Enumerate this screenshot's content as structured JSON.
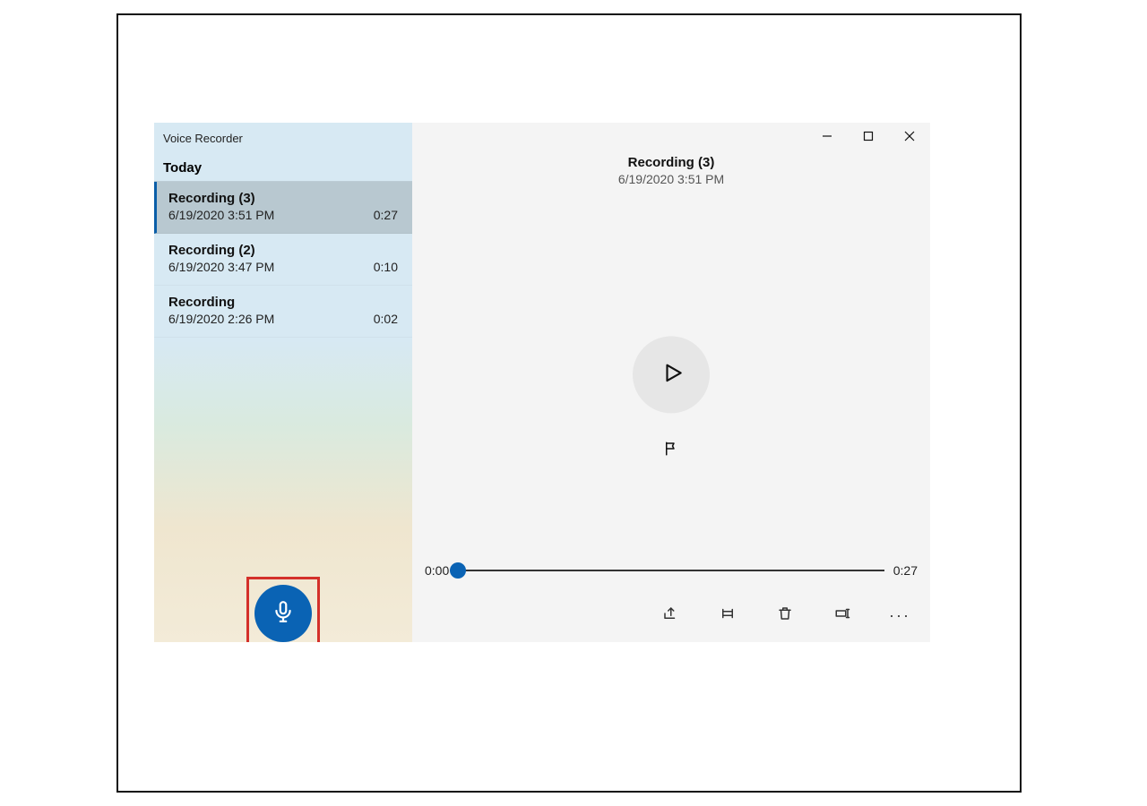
{
  "app": {
    "title": "Voice Recorder"
  },
  "sidebar": {
    "group": "Today",
    "items": [
      {
        "title": "Recording (3)",
        "datetime": "6/19/2020 3:51 PM",
        "duration": "0:27",
        "selected": true
      },
      {
        "title": "Recording (2)",
        "datetime": "6/19/2020 3:47 PM",
        "duration": "0:10",
        "selected": false
      },
      {
        "title": "Recording",
        "datetime": "6/19/2020 2:26 PM",
        "duration": "0:02",
        "selected": false
      }
    ]
  },
  "player": {
    "title": "Recording (3)",
    "datetime": "6/19/2020 3:51 PM",
    "position": "0:00",
    "duration": "0:27"
  },
  "icons": {
    "minimize": "minimize-icon",
    "maximize": "maximize-icon",
    "close": "close-icon",
    "play": "play-icon",
    "flag": "flag-icon",
    "microphone": "microphone-icon",
    "share": "share-icon",
    "trim": "trim-icon",
    "delete": "trash-icon",
    "rename": "rename-icon",
    "more": "more-icon"
  },
  "colors": {
    "accent": "#0a63b4",
    "highlight": "#d4302a"
  }
}
